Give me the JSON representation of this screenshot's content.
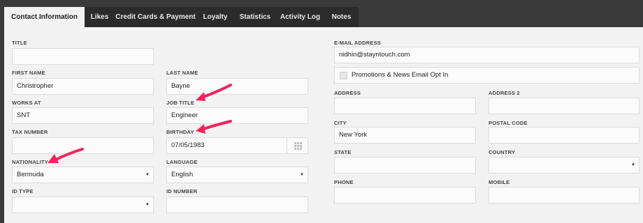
{
  "tabs": [
    {
      "label": "Contact Information"
    },
    {
      "label": "Likes"
    },
    {
      "label": "Credit Cards & Payment"
    },
    {
      "label": "Loyalty"
    },
    {
      "label": "Statistics"
    },
    {
      "label": "Activity Log"
    },
    {
      "label": "Notes"
    }
  ],
  "form": {
    "title": {
      "label": "TITLE",
      "value": ""
    },
    "first_name": {
      "label": "FIRST NAME",
      "value": "Christropher"
    },
    "last_name": {
      "label": "LAST NAME",
      "value": "Bayne"
    },
    "works_at": {
      "label": "WORKS AT",
      "value": "SNT"
    },
    "job_title": {
      "label": "JOB TITLE",
      "value": "Engineer"
    },
    "tax_number": {
      "label": "TAX NUMBER",
      "value": ""
    },
    "birthday": {
      "label": "BIRTHDAY",
      "value": "07/05/1983"
    },
    "nationality": {
      "label": "NATIONALITY",
      "value": "Bermuda"
    },
    "language": {
      "label": "LANGUAGE",
      "value": "English"
    },
    "id_type": {
      "label": "ID TYPE",
      "value": ""
    },
    "id_number": {
      "label": "ID NUMBER",
      "value": ""
    },
    "email": {
      "label": "E-MAIL ADDRESS",
      "value": "nidhin@stayntouch.com"
    },
    "promo_opt_in": {
      "label": "Promotions & News Email Opt In",
      "checked": false
    },
    "address": {
      "label": "ADDRESS",
      "value": ""
    },
    "address2": {
      "label": "ADDRESS 2",
      "value": ""
    },
    "city": {
      "label": "CITY",
      "value": "New York"
    },
    "postal_code": {
      "label": "POSTAL CODE",
      "value": ""
    },
    "state": {
      "label": "STATE",
      "value": ""
    },
    "country": {
      "label": "COUNTRY",
      "value": ""
    },
    "phone": {
      "label": "PHONE",
      "value": ""
    },
    "mobile": {
      "label": "MOBILE",
      "value": ""
    }
  },
  "icons": {
    "dropdown": "chevron-down-icon",
    "calendar": "calendar-grid-icon",
    "annotation": "pink-arrow-icon"
  },
  "colors": {
    "annotation_arrow": "#f0245e",
    "tab_active_bg": "#f2f2f2",
    "tab_bg": "#2b2b2b"
  }
}
